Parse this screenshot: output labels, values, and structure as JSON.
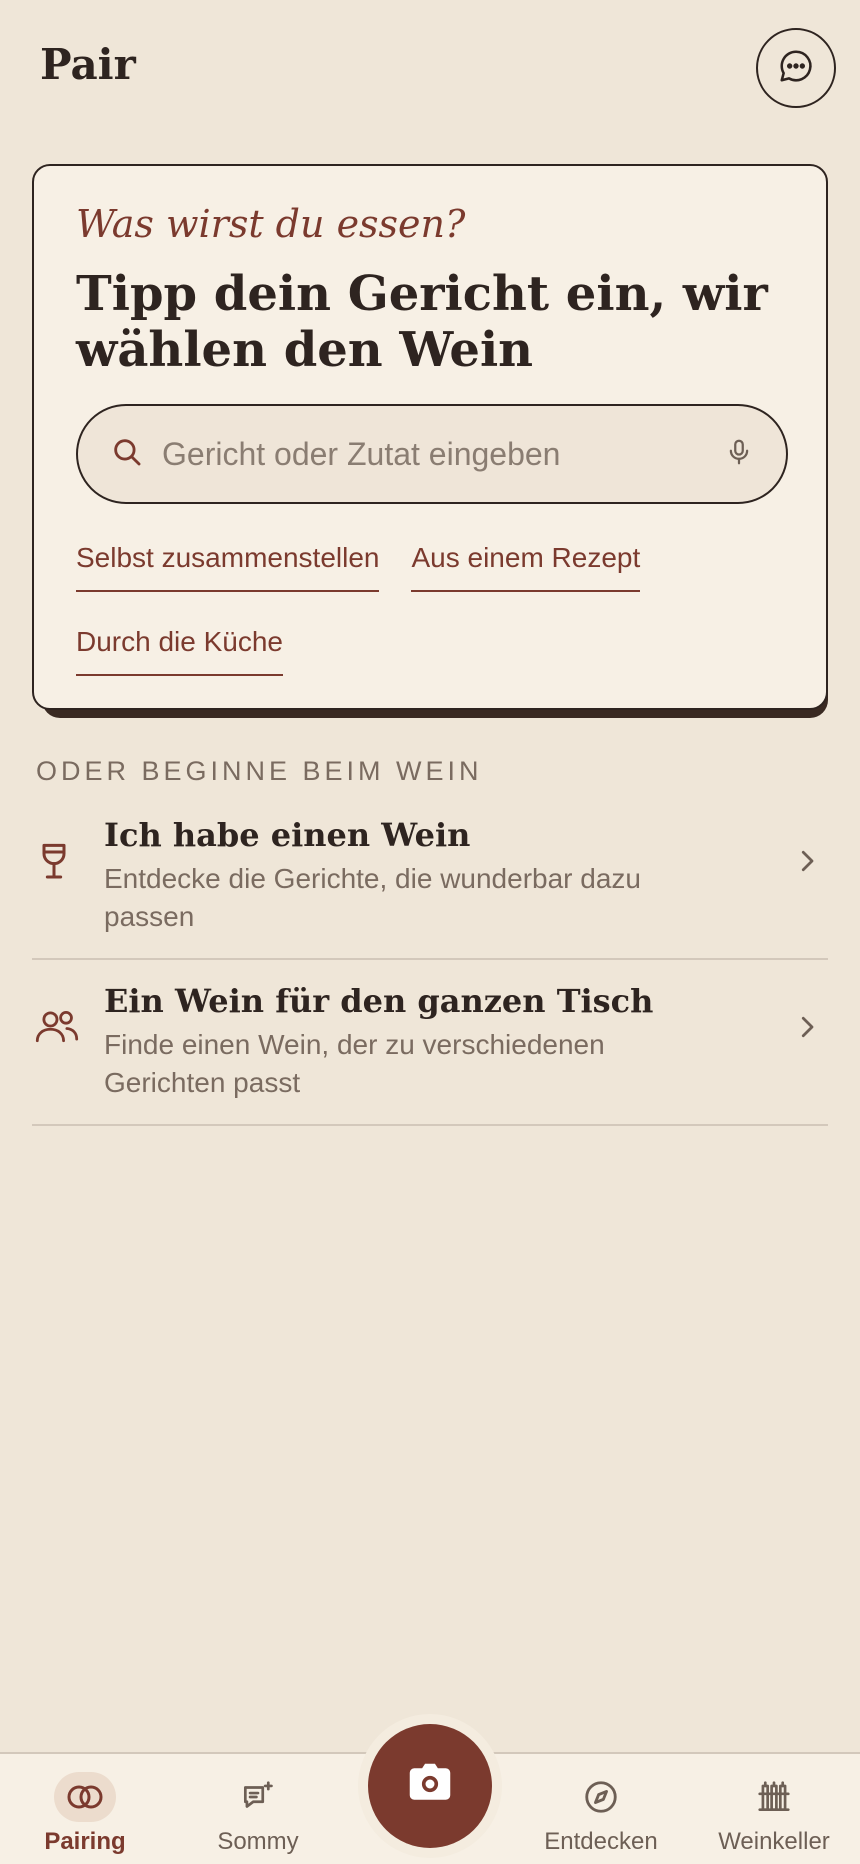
{
  "header": {
    "title": "Pair",
    "chat_icon": "chat-bubble-icon"
  },
  "card": {
    "eyebrow": "Was wirst du essen?",
    "heading": "Tipp dein Gericht ein, wir wählen den Wein",
    "search": {
      "placeholder": "Gericht oder Zutat eingeben",
      "icon": "search-icon",
      "mic_icon": "microphone-icon"
    },
    "links": [
      {
        "label": "Selbst zusammenstellen"
      },
      {
        "label": "Aus einem Rezept"
      },
      {
        "label": "Durch die Küche"
      }
    ]
  },
  "section": {
    "label": "ODER BEGINNE BEIM WEIN",
    "items": [
      {
        "title": "Ich habe einen Wein",
        "subtitle": "Entdecke die Gerichte, die wunderbar dazu passen",
        "icon": "wine-glass-icon"
      },
      {
        "title": "Ein Wein für den ganzen Tisch",
        "subtitle": "Finde einen Wein, der zu verschiedenen Gerichten passt",
        "icon": "people-icon"
      }
    ]
  },
  "nav": {
    "items": [
      {
        "label": "Pairing",
        "icon": "pairing-rings-icon",
        "active": true
      },
      {
        "label": "Sommy",
        "icon": "chat-sparkle-icon"
      },
      {
        "label": "Entdecken",
        "icon": "compass-icon"
      },
      {
        "label": "Weinkeller",
        "icon": "wine-rack-icon"
      }
    ],
    "camera_icon": "camera-icon"
  },
  "colors": {
    "background": "#efe6d8",
    "card": "#f7f0e5",
    "accent": "#7b3a2e",
    "text": "#2e2420",
    "muted": "#7a6b60"
  }
}
